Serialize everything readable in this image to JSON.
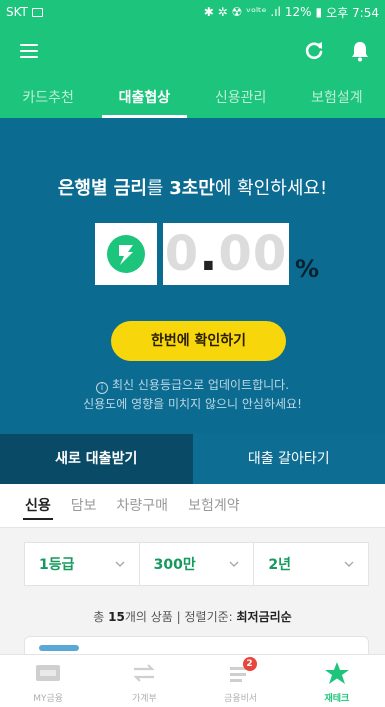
{
  "status_bar": {
    "carrier": "SKT",
    "indicators": "✱ ✲ ☢ ᵛᵒˡᵗᵉ .ıl",
    "battery": "12%",
    "time": "오후 7:54"
  },
  "header": {
    "menu_icon": "hamburger-menu-icon",
    "refresh_icon": "refresh-icon",
    "bell_icon": "bell-icon"
  },
  "top_tabs": [
    {
      "label": "카드추천",
      "active": false
    },
    {
      "label": "대출협상",
      "active": true
    },
    {
      "label": "신용관리",
      "active": false
    },
    {
      "label": "보험설계",
      "active": false
    }
  ],
  "hero": {
    "headline_part1": "은행별 금리",
    "headline_part2": "를 ",
    "headline_part3": "3초만",
    "headline_part4": "에 확인하세요!",
    "rate_int": "0",
    "rate_dot": ".",
    "rate_frac": "00",
    "percent": "%",
    "cta_label": "한번에 확인하기",
    "notice_icon": "i",
    "notice_line1": "최신 신용등급으로 업데이트합니다.",
    "notice_line2": "신용도에 영향을 미치지 않으니 안심하세요!",
    "colors": {
      "background": "#0b6b91",
      "cta": "#f8d60c",
      "brand": "#1dc47c"
    }
  },
  "sub_tabs": [
    {
      "label": "새로 대출받기",
      "active": true
    },
    {
      "label": "대출 갈아타기",
      "active": false
    }
  ],
  "loan_types": [
    {
      "label": "신용",
      "active": true
    },
    {
      "label": "담보",
      "active": false
    },
    {
      "label": "차량구매",
      "active": false
    },
    {
      "label": "보험계약",
      "active": false
    }
  ],
  "filters": [
    {
      "value": "1등급"
    },
    {
      "value": "300만"
    },
    {
      "value": "2년"
    }
  ],
  "summary": {
    "prefix": "총 ",
    "count": "15",
    "mid": "개의 상품 | 정렬기준: ",
    "sort": "최저금리순"
  },
  "bottom_nav": [
    {
      "label": "MY금융",
      "icon": "wallet-icon",
      "active": false
    },
    {
      "label": "가계부",
      "icon": "transfer-arrows-icon",
      "active": false
    },
    {
      "label": "금융비서",
      "icon": "message-icon",
      "active": false,
      "badge": "2"
    },
    {
      "label": "재테크",
      "icon": "star-icon",
      "active": true
    }
  ]
}
